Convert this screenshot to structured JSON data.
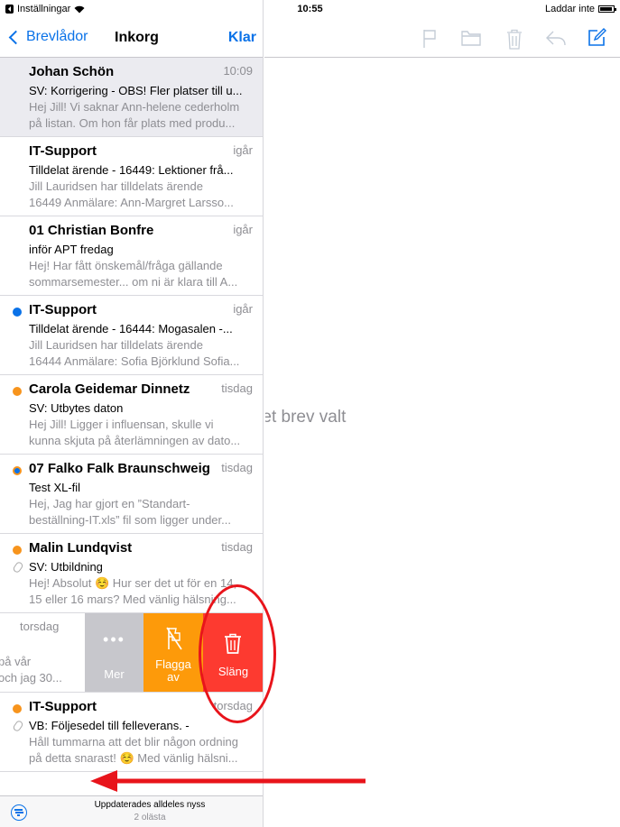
{
  "status_bar": {
    "back_app": "Inställningar",
    "time": "10:55",
    "charging": "Laddar inte"
  },
  "nav": {
    "back_label": "Brevlådor",
    "title": "Inkorg",
    "done_label": "Klar"
  },
  "messages": [
    {
      "sender": "Johan Schön",
      "time": "10:09",
      "subject": "SV: Korrigering - OBS! Fler platser till u...",
      "preview1": "Hej Jill! Vi saknar Ann-helene cederholm",
      "preview2": "på listan. Om hon får plats med produ...",
      "marker": "none",
      "selected": true
    },
    {
      "sender": "IT-Support",
      "time": "igår",
      "subject": "Tilldelat ärende - 16449: Lektioner frå...",
      "preview1": "Jill Lauridsen har tilldelats ärende",
      "preview2": "16449 Anmälare: Ann-Margret Larsso...",
      "marker": "none"
    },
    {
      "sender": "01 Christian Bonfre",
      "time": "igår",
      "subject": "inför APT fredag",
      "preview1": "Hej! Har fått önskemål/fråga gällande",
      "preview2": "sommarsemester... om ni är klara till A...",
      "marker": "none"
    },
    {
      "sender": "IT-Support",
      "time": "igår",
      "subject": "Tilldelat ärende - 16444: Mogasalen -...",
      "preview1": "Jill Lauridsen har tilldelats ärende",
      "preview2": "16444 Anmälare: Sofia Björklund Sofia...",
      "marker": "blue"
    },
    {
      "sender": "Carola Geidemar Dinnetz",
      "time": "tisdag",
      "subject": "SV: Utbytes daton",
      "preview1": "Hej Jill! Ligger i influensan, skulle vi",
      "preview2": "kunna skjuta på återlämningen av dato...",
      "marker": "orange"
    },
    {
      "sender": "07 Falko Falk Braunschweig",
      "time": "tisdag",
      "subject": "Test XL-fil",
      "preview1": "Hej, Jag har gjort en ”Standart-",
      "preview2": "beställning-IT.xls” fil som ligger under...",
      "marker": "orange-ring"
    },
    {
      "sender": "Malin Lundqvist",
      "time": "tisdag",
      "subject": "SV: Utbildning",
      "preview1": "Hej! Absolut ☺️ Hur ser det ut för en 14,",
      "preview2": "15 eller 16 mars? Med vänlig hälsning...",
      "marker": "orange",
      "attachment": true
    }
  ],
  "swiped": {
    "time": "torsdag",
    "preview1": "på vår",
    "preview2": "och jag 30...",
    "actions": {
      "more": "Mer",
      "flag_line1": "Flagga",
      "flag_line2": "av",
      "trash": "Släng"
    }
  },
  "last_message": {
    "sender": "IT-Support",
    "time": "torsdag",
    "subject": "VB: Följesedel till felleverans. -",
    "preview1": "Håll tummarna att det blir någon ordning",
    "preview2": "på detta snarast! ☺️ Med vänlig hälsni...",
    "marker": "orange",
    "attachment": true
  },
  "toolbar": {
    "status": "Uppdaterades alldeles nyss",
    "unread": "2 olästa"
  },
  "detail": {
    "empty_message": "Inget brev valt"
  },
  "colors": {
    "accent": "#0a72e8",
    "trash": "#fd3a30",
    "flag": "#fd9a0a",
    "more": "#c7c7cc",
    "annotation": "#e8141b"
  }
}
